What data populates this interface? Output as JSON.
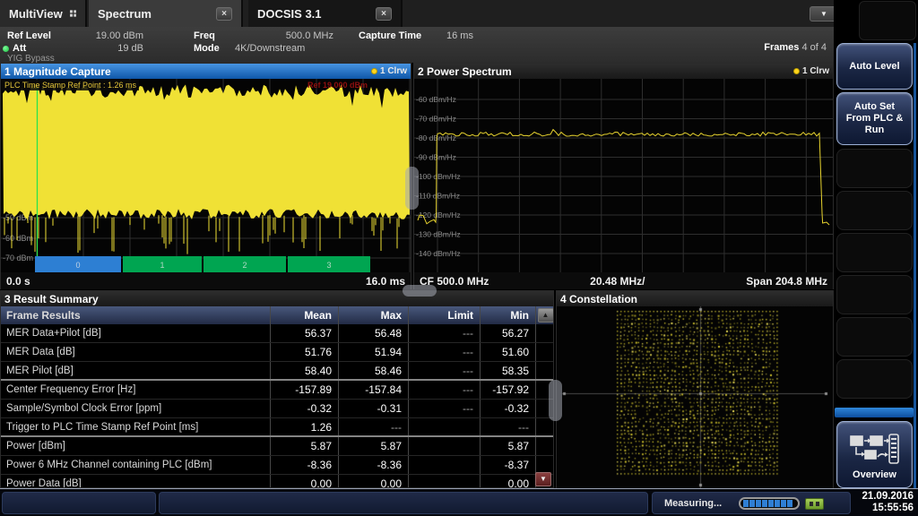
{
  "tabs": [
    {
      "label": "MultiView"
    },
    {
      "label": "Spectrum",
      "close": "x"
    },
    {
      "label": "DOCSIS 3.1",
      "close": "x"
    }
  ],
  "header": {
    "ref_level_label": "Ref Level",
    "ref_level": "19.00 dBm",
    "att_label": "Att",
    "att": "19 dB",
    "freq_label": "Freq",
    "freq": "500.0 MHz",
    "mode_label": "Mode",
    "mode": "4K/Downstream",
    "capture_time_label": "Capture Time",
    "capture_time": "16 ms",
    "frames_label": "Frames",
    "frames": "4 of 4",
    "yig": "YIG Bypass"
  },
  "win1": {
    "title": "1 Magnitude Capture",
    "trace_label": "1 Clrw",
    "plc_label": "PLC Time Stamp Ref Point : 1.26 ms",
    "ref_label": "Ref 19.000 dBm",
    "y_ticks": [
      "-50 dBm",
      "-60 dBm",
      "-70 dBm"
    ],
    "x_start": "0.0 s",
    "x_end": "16.0 ms",
    "segments": [
      {
        "label": "0",
        "color": "#2d7fd3"
      },
      {
        "label": "1",
        "color": "#00a551"
      },
      {
        "label": "2",
        "color": "#00a551"
      },
      {
        "label": "3",
        "color": "#00a551"
      }
    ]
  },
  "win2": {
    "title": "2 Power Spectrum",
    "trace_label": "1 Clrw",
    "y_ticks": [
      "-60 dBm/Hz",
      "-70 dBm/Hz",
      "-80 dBm/Hz",
      "-90 dBm/Hz",
      "-100 dBm/Hz",
      "-110 dBm/Hz",
      "-120 dBm/Hz",
      "-130 dBm/Hz",
      "-140 dBm/Hz"
    ],
    "cf": "CF 500.0 MHz",
    "per_div": "20.48 MHz/",
    "span": "Span 204.8 MHz"
  },
  "win3": {
    "title": "3 Result Summary",
    "columns": [
      "Frame Results",
      "Mean",
      "Max",
      "Limit",
      "Min"
    ],
    "rows": [
      {
        "label": "MER Data+Pilot [dB]",
        "mean": "56.37",
        "max": "56.48",
        "limit": "---",
        "min": "56.27"
      },
      {
        "label": "MER Data [dB]",
        "mean": "51.76",
        "max": "51.94",
        "limit": "---",
        "min": "51.60"
      },
      {
        "label": "MER Pilot [dB]",
        "mean": "58.40",
        "max": "58.46",
        "limit": "---",
        "min": "58.35",
        "group_end": true
      },
      {
        "label": "Center Frequency Error [Hz]",
        "mean": "-157.89",
        "max": "-157.84",
        "limit": "---",
        "min": "-157.92"
      },
      {
        "label": "Sample/Symbol Clock Error [ppm]",
        "mean": "-0.32",
        "max": "-0.31",
        "limit": "---",
        "min": "-0.32"
      },
      {
        "label": "Trigger to PLC Time Stamp Ref Point [ms]",
        "mean": "1.26",
        "max": "---",
        "limit": "",
        "min": "---",
        "group_end": true
      },
      {
        "label": "Power [dBm]",
        "mean": "5.87",
        "max": "5.87",
        "limit": "",
        "min": "5.87"
      },
      {
        "label": "Power 6 MHz Channel containing PLC [dBm]",
        "mean": "-8.36",
        "max": "-8.36",
        "limit": "",
        "min": "-8.37"
      },
      {
        "label": "Power Data [dB]",
        "mean": "0.00",
        "max": "0.00",
        "limit": "",
        "min": "0.00"
      }
    ]
  },
  "win4": {
    "title": "4 Constellation"
  },
  "sidebar": {
    "auto_level": "Auto Level",
    "auto_set": "Auto Set From PLC & Run",
    "overview": "Overview"
  },
  "status": {
    "measuring": "Measuring...",
    "date": "21.09.2016",
    "time": "15:55:56"
  },
  "colors": {
    "titlebar_blue": "#1a6ec8",
    "trace_yellow": "#f0e135",
    "segment_green": "#00a551",
    "segment_blue": "#2d7fd3",
    "led_green": "#2ecc40"
  }
}
